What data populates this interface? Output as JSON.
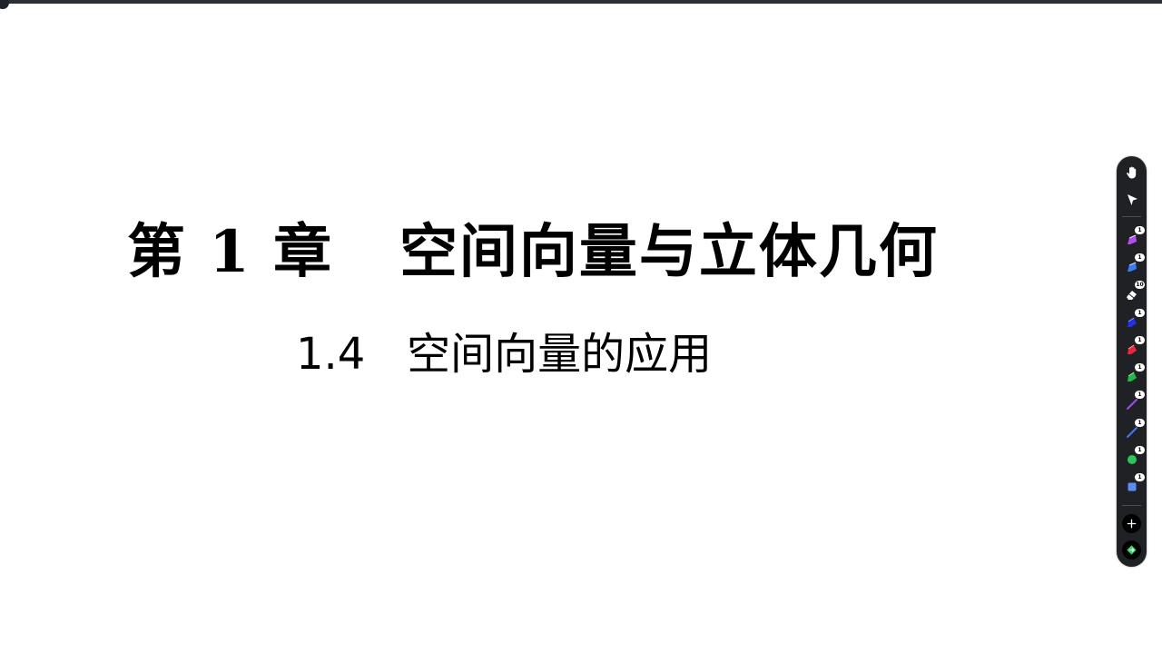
{
  "slide": {
    "chapter_prefix": "第",
    "chapter_number": "1",
    "chapter_suffix": "章",
    "chapter_name": "空间向量与立体几何",
    "section_number": "1.4",
    "section_name": "空间向量的应用"
  },
  "toolbar": {
    "tools": [
      {
        "name": "hand-tool",
        "icon": "hand-icon"
      },
      {
        "name": "select-tool",
        "icon": "cursor-arrow-icon"
      },
      {
        "name": "purple-pen-tool",
        "icon": "pen-icon",
        "color": "#b14cf0",
        "badge": "1"
      },
      {
        "name": "blue-pen-tool",
        "icon": "pen-icon",
        "color": "#3b7bf5",
        "badge": "1"
      },
      {
        "name": "eraser-tool",
        "icon": "eraser-icon",
        "color": "#ffffff",
        "badge": "10"
      },
      {
        "name": "dark-blue-highlighter-tool",
        "icon": "highlighter-icon",
        "color": "#2030e8",
        "badge": "1"
      },
      {
        "name": "red-highlighter-tool",
        "icon": "highlighter-icon",
        "color": "#e8283a",
        "badge": "1"
      },
      {
        "name": "green-highlighter-tool",
        "icon": "highlighter-icon",
        "color": "#1fb84a",
        "badge": "1"
      },
      {
        "name": "purple-line-tool",
        "icon": "line-icon",
        "color": "#9a4cf0",
        "badge": "1"
      },
      {
        "name": "blue-line-tool",
        "icon": "line-icon",
        "color": "#3b7bf5",
        "badge": "1"
      },
      {
        "name": "green-circle-tool",
        "icon": "circle-icon",
        "color": "#2ec45a",
        "badge": "1"
      },
      {
        "name": "blue-square-tool",
        "icon": "square-icon",
        "color": "#5b8ef5",
        "badge": "1"
      }
    ],
    "add_button_icon": "plus-icon",
    "share_button_icon": "diamond-arrow-icon"
  },
  "colors": {
    "toolbar_bg": "#202124",
    "top_bar": "#2b2f36",
    "text": "#000000"
  }
}
